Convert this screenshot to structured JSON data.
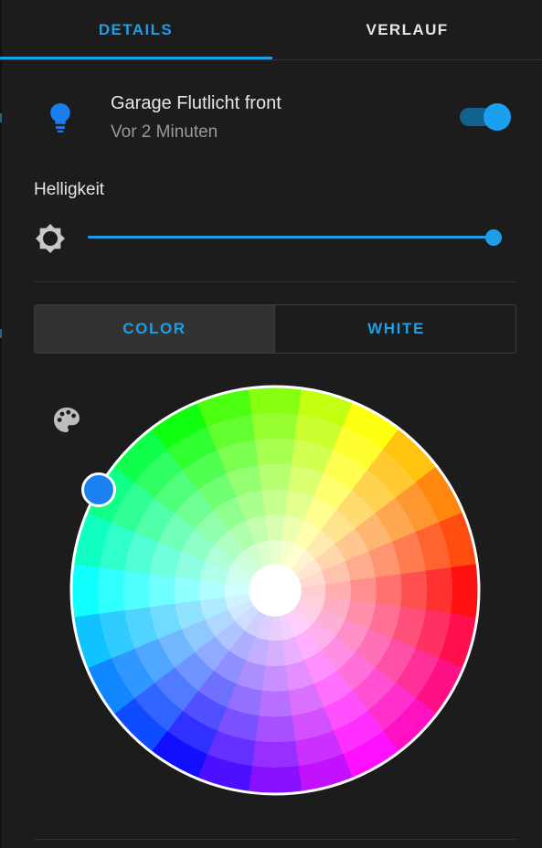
{
  "tabs": {
    "details_label": "DETAILS",
    "verlauf_label": "VERLAUF",
    "active": "details"
  },
  "entity": {
    "name": "Garage Flutlicht front",
    "last_changed": "Vor 2 Minuten",
    "icon": "lightbulb-icon",
    "state_on": true
  },
  "brightness": {
    "label": "Helligkeit",
    "icon": "brightness-icon",
    "level_percent": 100
  },
  "mode": {
    "color_label": "COLOR",
    "white_label": "WHITE",
    "selected": "color"
  },
  "color_picker": {
    "palette_icon": "palette-icon",
    "selected_color": "#1b80f0"
  },
  "colors": {
    "accent": "#1e9ee6",
    "toggle_track": "#13618e",
    "toggle_thumb": "#1aa0ef",
    "bulb": "#1b7ef0",
    "background": "#1c1c1c"
  }
}
